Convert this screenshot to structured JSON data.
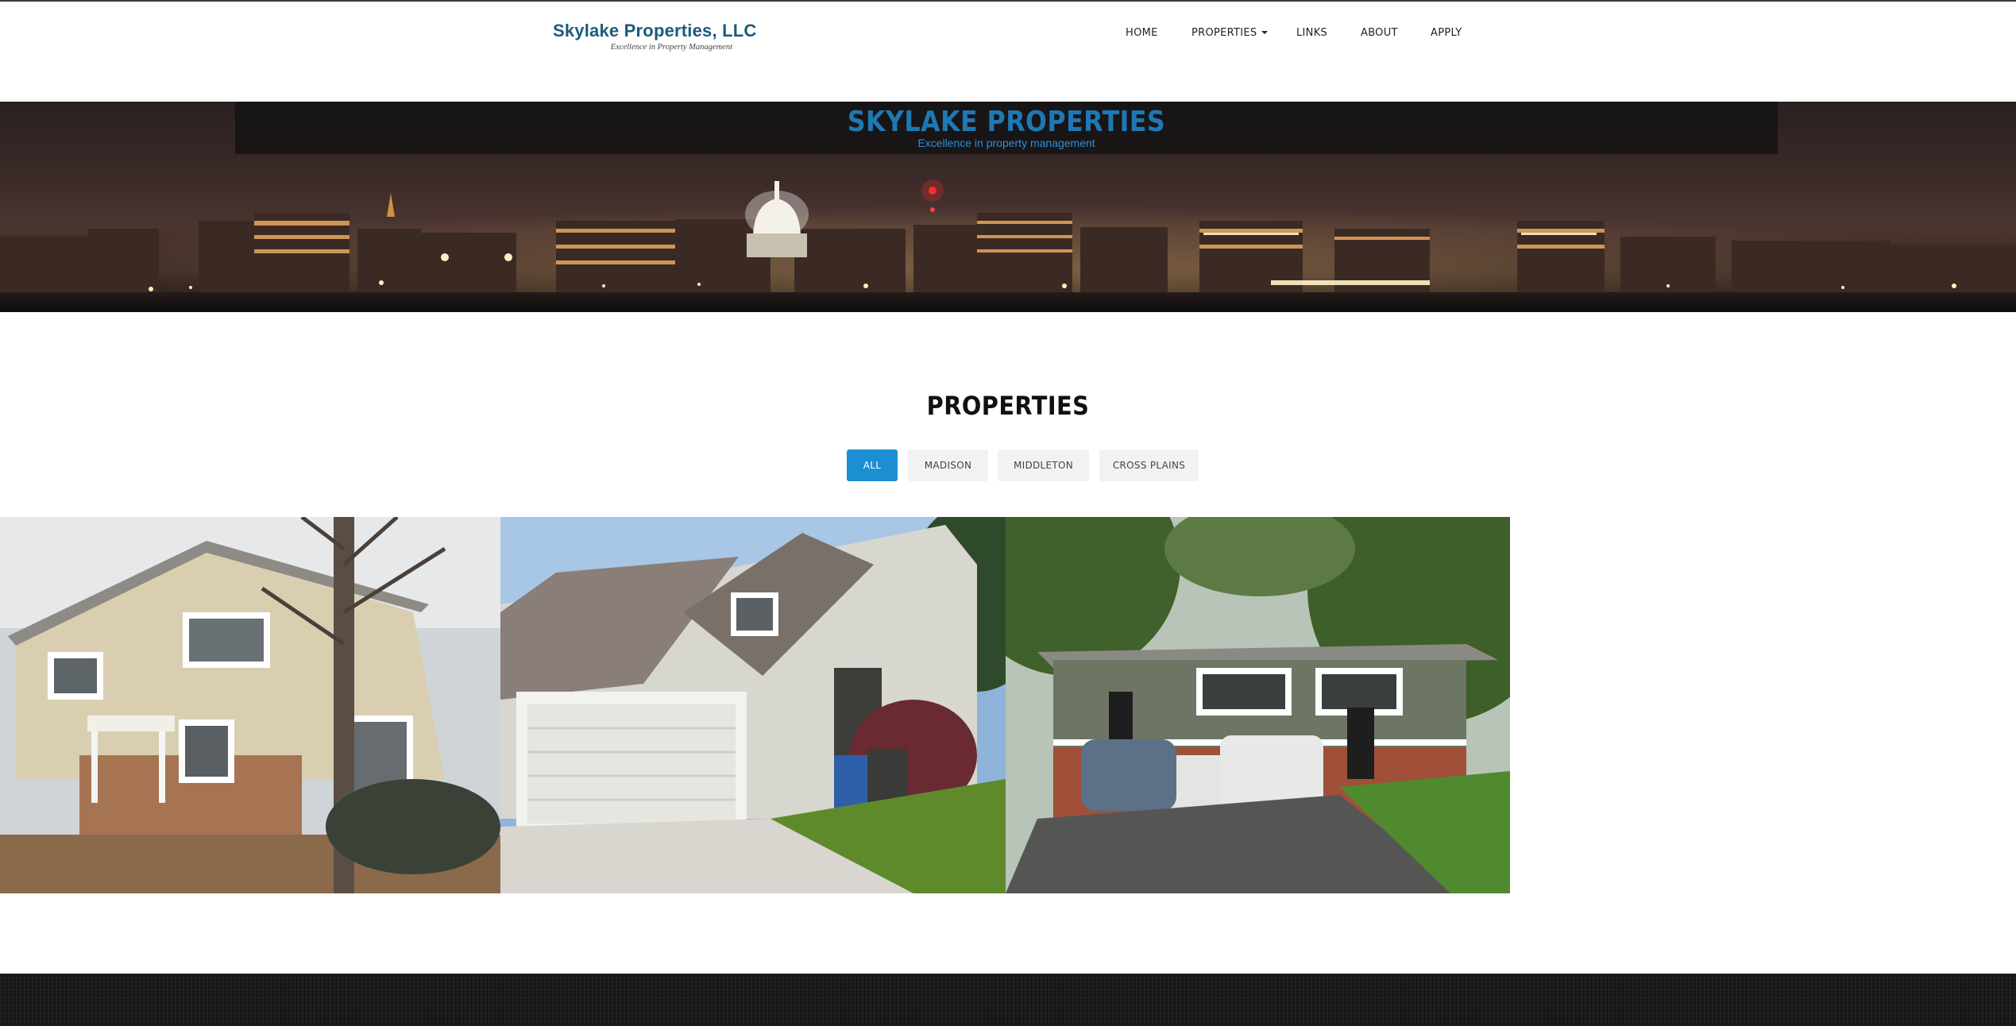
{
  "header": {
    "logo_title": "Skylake Properties, LLC",
    "logo_tagline": "Excellence in Property Management"
  },
  "nav": {
    "items": [
      {
        "label": "HOME"
      },
      {
        "label": "PROPERTIES",
        "has_dropdown": true
      },
      {
        "label": "LINKS"
      },
      {
        "label": "ABOUT"
      },
      {
        "label": "APPLY"
      }
    ]
  },
  "hero": {
    "title": "SKYLAKE PROPERTIES",
    "subtitle": "Excellence in property management"
  },
  "properties": {
    "heading": "PROPERTIES",
    "filters": [
      {
        "label": "ALL",
        "active": true
      },
      {
        "label": "MADISON",
        "active": false
      },
      {
        "label": "MIDDLETON",
        "active": false
      },
      {
        "label": "CROSS PLAINS",
        "active": false
      }
    ]
  },
  "colors": {
    "brand_blue": "#1c5a7c",
    "accent_blue": "#1b8fd2",
    "hero_title": "#1e78b4",
    "footer": "#151515"
  }
}
